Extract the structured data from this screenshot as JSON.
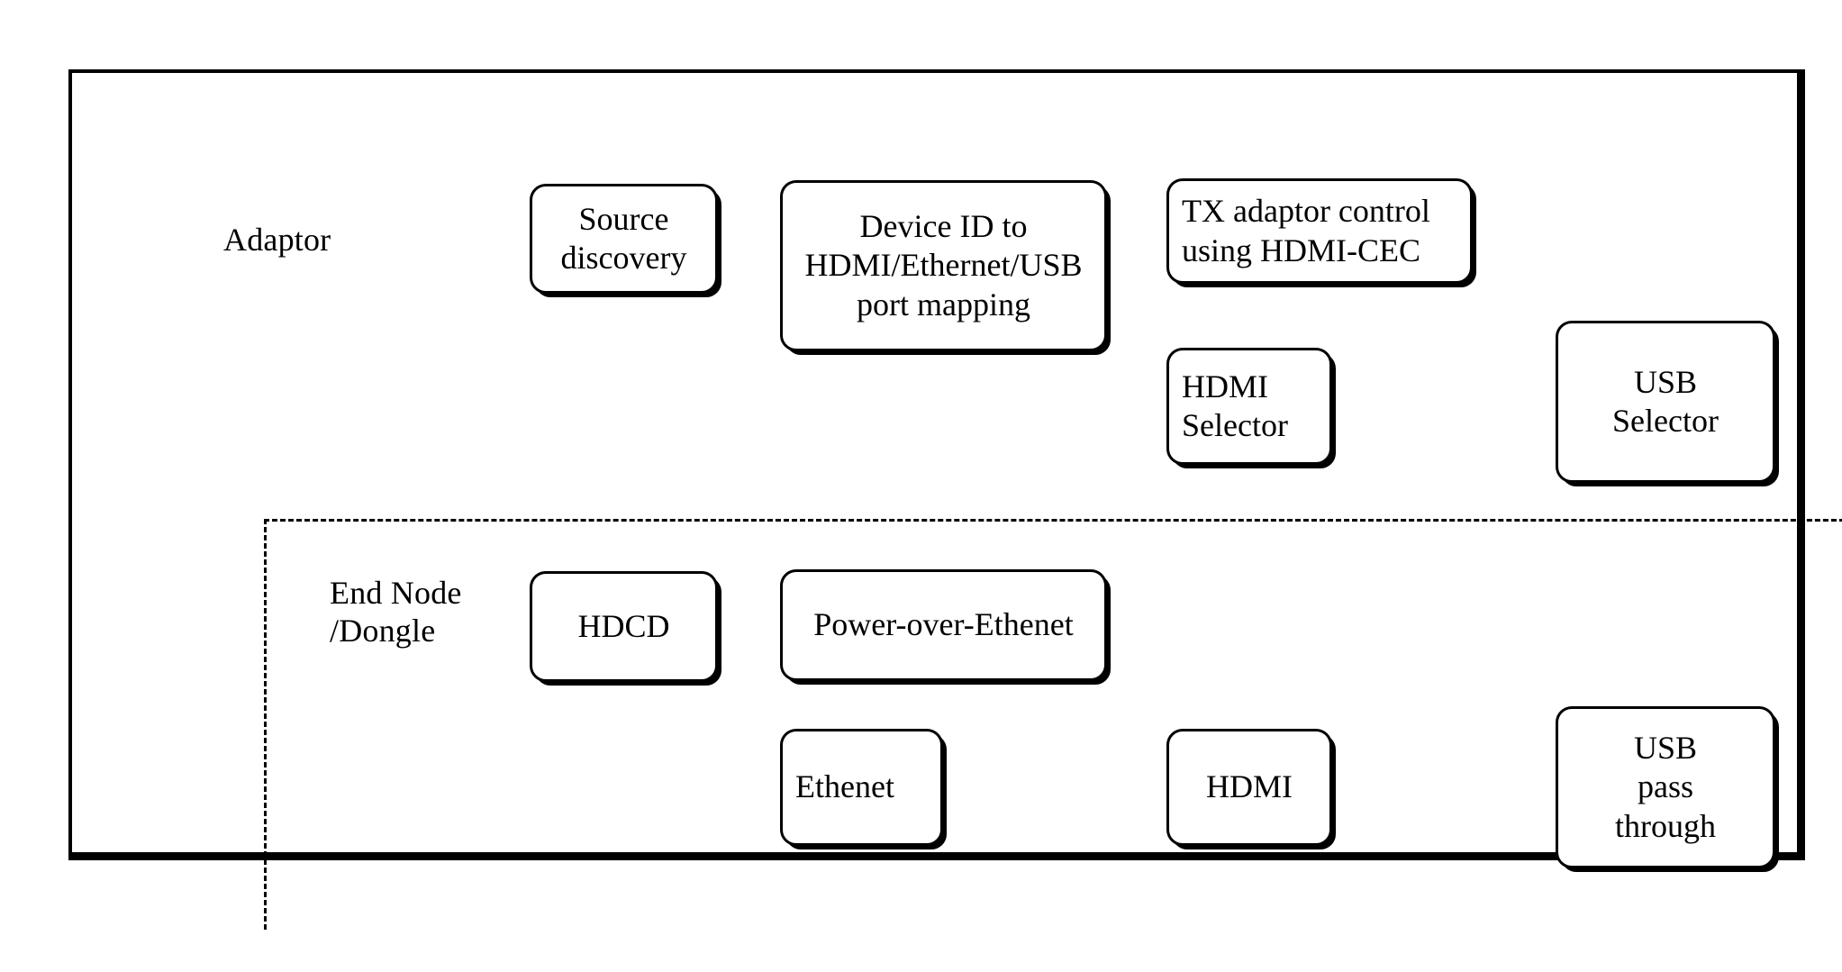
{
  "figure": {
    "type": "layered-block-diagram",
    "sections": [
      {
        "id": "adaptor",
        "label": "Adaptor"
      },
      {
        "id": "end-node",
        "label": "End Node\n/Dongle"
      }
    ]
  },
  "adaptor": {
    "label": "Adaptor",
    "nodes": [
      {
        "id": "source-discovery",
        "label": "Source\ndiscovery",
        "align": "center"
      },
      {
        "id": "device-id-mapping",
        "label": "Device ID to\nHDMI/Ethernet/USB\nport mapping",
        "align": "center"
      },
      {
        "id": "tx-adaptor-control",
        "label": "TX adaptor control\nusing HDMI-CEC",
        "align": "left"
      },
      {
        "id": "hdmi-selector",
        "label": "HDMI\nSelector",
        "align": "left"
      },
      {
        "id": "usb-selector",
        "label": "USB\nSelector",
        "align": "center"
      }
    ]
  },
  "end_node": {
    "label": "End Node\n/Dongle",
    "nodes": [
      {
        "id": "hdcd",
        "label": "HDCD",
        "align": "center"
      },
      {
        "id": "power-over-ethernet",
        "label": "Power-over-Ethenet",
        "align": "center"
      },
      {
        "id": "ethernet",
        "label": "Ethenet",
        "align": "left"
      },
      {
        "id": "hdmi",
        "label": "HDMI",
        "align": "center"
      },
      {
        "id": "usb-pass-through",
        "label": "USB\npass\nthrough",
        "align": "center"
      }
    ]
  },
  "colors": {
    "stroke": "#000000",
    "fill": "#ffffff",
    "background": "#ffffff"
  }
}
